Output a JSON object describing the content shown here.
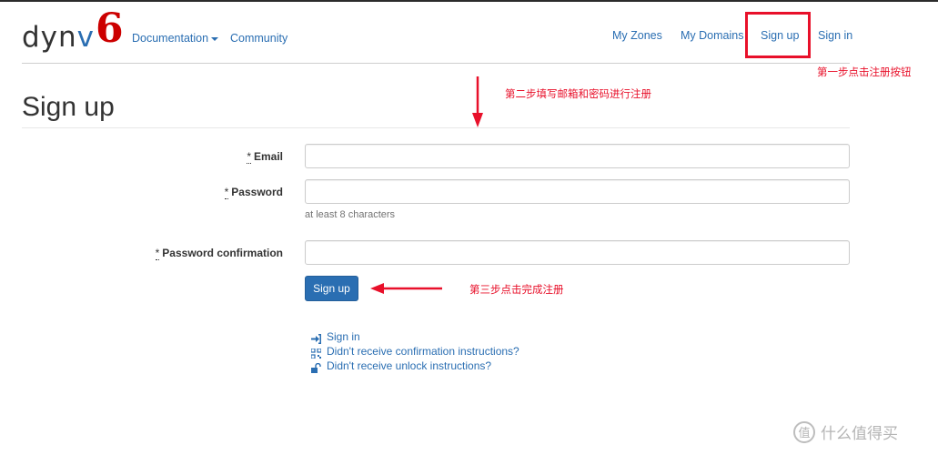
{
  "logo": {
    "part1": "dyn",
    "part2": "v",
    "part3": "6"
  },
  "nav": {
    "documentation": "Documentation",
    "community": "Community",
    "my_zones": "My Zones",
    "my_domains": "My Domains",
    "sign_up": "Sign up",
    "sign_in": "Sign in"
  },
  "annotations": {
    "step1": "第一步点击注册按钮",
    "step2": "第二步填写邮箱和密码进行注册",
    "step3": "第三步点击完成注册"
  },
  "page": {
    "title": "Sign up"
  },
  "form": {
    "required_mark": "*",
    "email_label": "Email",
    "email_value": "",
    "password_label": "Password",
    "password_value": "",
    "password_help": "at least 8 characters",
    "confirm_label": "Password confirmation",
    "confirm_value": "",
    "submit_label": "Sign up"
  },
  "links": {
    "sign_in": "Sign in",
    "confirmation": "Didn't receive confirmation instructions?",
    "unlock": "Didn't receive unlock instructions?"
  },
  "watermark": {
    "badge": "值",
    "text": "什么值得买"
  },
  "colors": {
    "link": "#2a6eb2",
    "annotation": "#e8102a",
    "logo_six": "#cc0000",
    "button": "#2a6eb2"
  }
}
